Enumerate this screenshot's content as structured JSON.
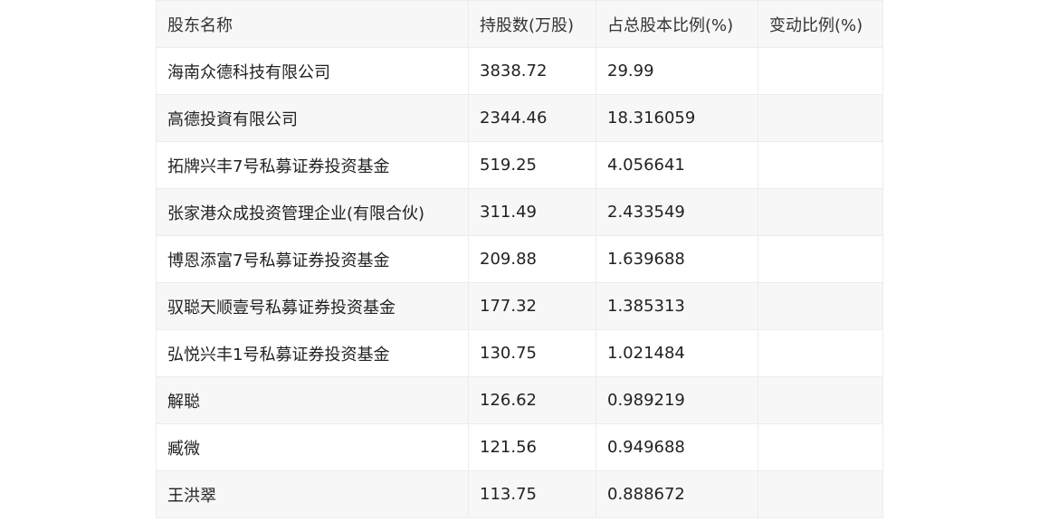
{
  "table": {
    "headers": [
      "股东名称",
      "持股数(万股)",
      "占总股本比例(%)",
      "变动比例(%)"
    ],
    "rows": [
      [
        "海南众德科技有限公司",
        "3838.72",
        "29.99",
        ""
      ],
      [
        "高德投資有限公司",
        "2344.46",
        "18.316059",
        ""
      ],
      [
        "拓牌兴丰7号私募证券投资基金",
        "519.25",
        "4.056641",
        ""
      ],
      [
        "张家港众成投资管理企业(有限合伙)",
        "311.49",
        "2.433549",
        ""
      ],
      [
        "博恩添富7号私募证券投资基金",
        "209.88",
        "1.639688",
        ""
      ],
      [
        "驭聪天顺壹号私募证券投资基金",
        "177.32",
        "1.385313",
        ""
      ],
      [
        "弘悦兴丰1号私募证券投资基金",
        "130.75",
        "1.021484",
        ""
      ],
      [
        "解聪",
        "126.62",
        "0.989219",
        ""
      ],
      [
        "臧微",
        "121.56",
        "0.949688",
        ""
      ],
      [
        "王洪翠",
        "113.75",
        "0.888672",
        ""
      ]
    ]
  }
}
